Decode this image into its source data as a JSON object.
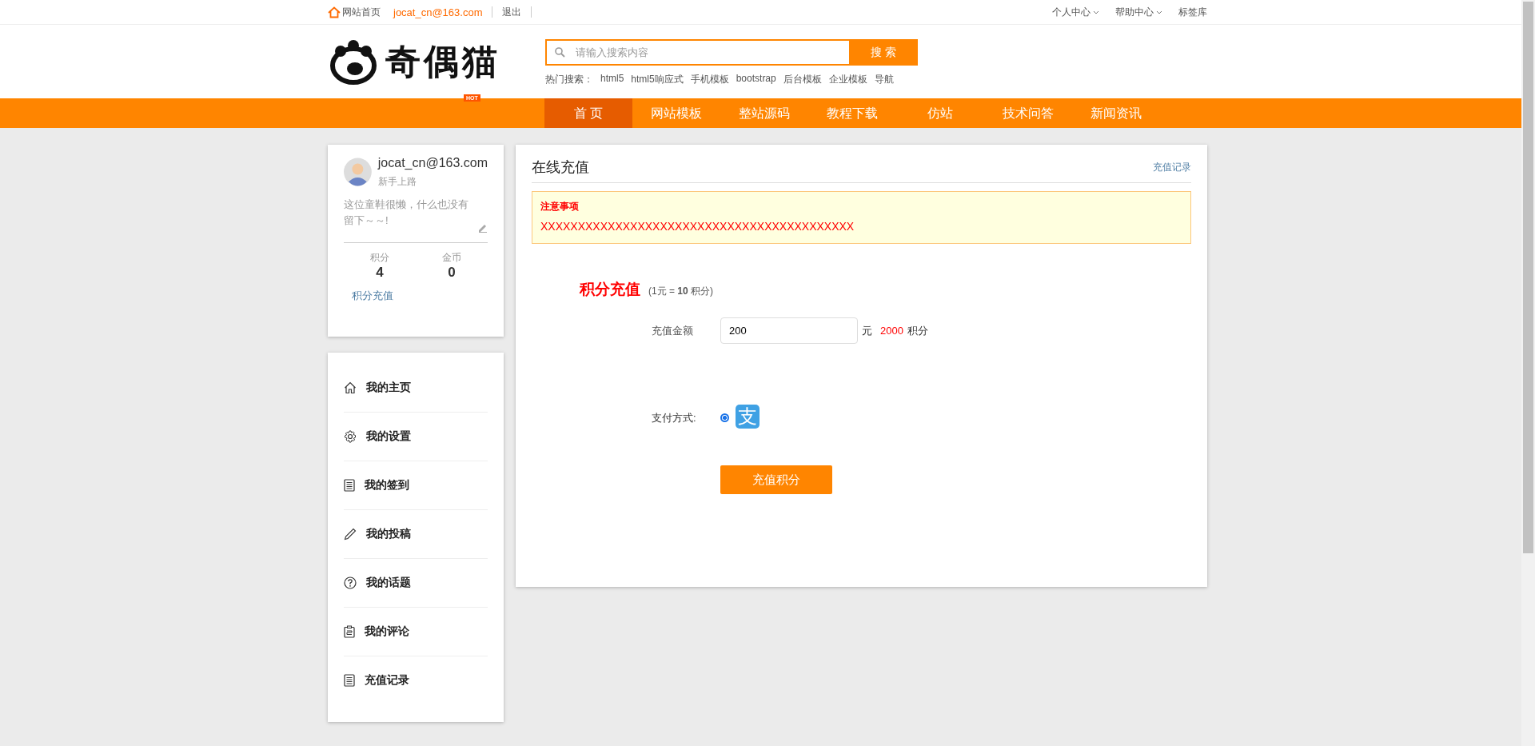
{
  "top_bar": {
    "home_link": "网站首页",
    "user_link": "jocat_cn@163.com",
    "logout_link": "退出",
    "right_links": [
      {
        "label": "个人中心",
        "dropdown": true
      },
      {
        "label": "帮助中心",
        "dropdown": true
      },
      {
        "label": "标签库",
        "dropdown": false
      }
    ]
  },
  "header": {
    "logo_text": "奇偶猫",
    "badge": "HOT",
    "search": {
      "placeholder": "请输入搜索内容",
      "button": "搜 索"
    },
    "hot_label": "热门搜索：",
    "hot_terms": [
      "html5",
      "html5响应式",
      "手机模板",
      "bootstrap",
      "后台模板",
      "企业模板",
      "导航"
    ]
  },
  "nav": [
    {
      "label": "首 页",
      "selected": true
    },
    {
      "label": "网站模板",
      "selected": false
    },
    {
      "label": "整站源码",
      "selected": false
    },
    {
      "label": "教程下载",
      "selected": false
    },
    {
      "label": "仿站",
      "selected": false
    },
    {
      "label": "技术问答",
      "selected": false
    },
    {
      "label": "新闻资讯",
      "selected": false
    }
  ],
  "profile": {
    "name": "jocat_cn@163.com",
    "level": "新手上路",
    "bio": "这位童鞋很懒，什么也没有留下～～!",
    "stats": [
      {
        "label": "积分",
        "value": "4"
      },
      {
        "label": "金币",
        "value": "0"
      }
    ],
    "recharge_link": "积分充值"
  },
  "menu": [
    {
      "label": "我的主页",
      "kind": "home"
    },
    {
      "label": "我的设置",
      "kind": "gear"
    },
    {
      "label": "我的签到",
      "kind": "list"
    },
    {
      "label": "我的投稿",
      "kind": "pencil"
    },
    {
      "label": "我的话题",
      "kind": "question"
    },
    {
      "label": "我的评论",
      "kind": "clipboard"
    },
    {
      "label": "充值记录",
      "kind": "list"
    }
  ],
  "panel": {
    "title": "在线充值",
    "history_link": "充值记录",
    "notice": {
      "title": "注意事项",
      "text": "XXXXXXXXXXXXXXXXXXXXXXXXXXXXXXXXXXXXXXXXXX"
    },
    "recharge": {
      "heading": "积分充值",
      "rate": "(1元 = **10** 积分)",
      "amount_label": "充值金额",
      "amount_value": "200",
      "unit": "元",
      "points": "2000",
      "points_unit": "积分",
      "pay_label": "支付方式:",
      "pay_methods": [
        {
          "icon_text": "支",
          "selected": true
        }
      ],
      "submit": "充值积分"
    }
  }
}
